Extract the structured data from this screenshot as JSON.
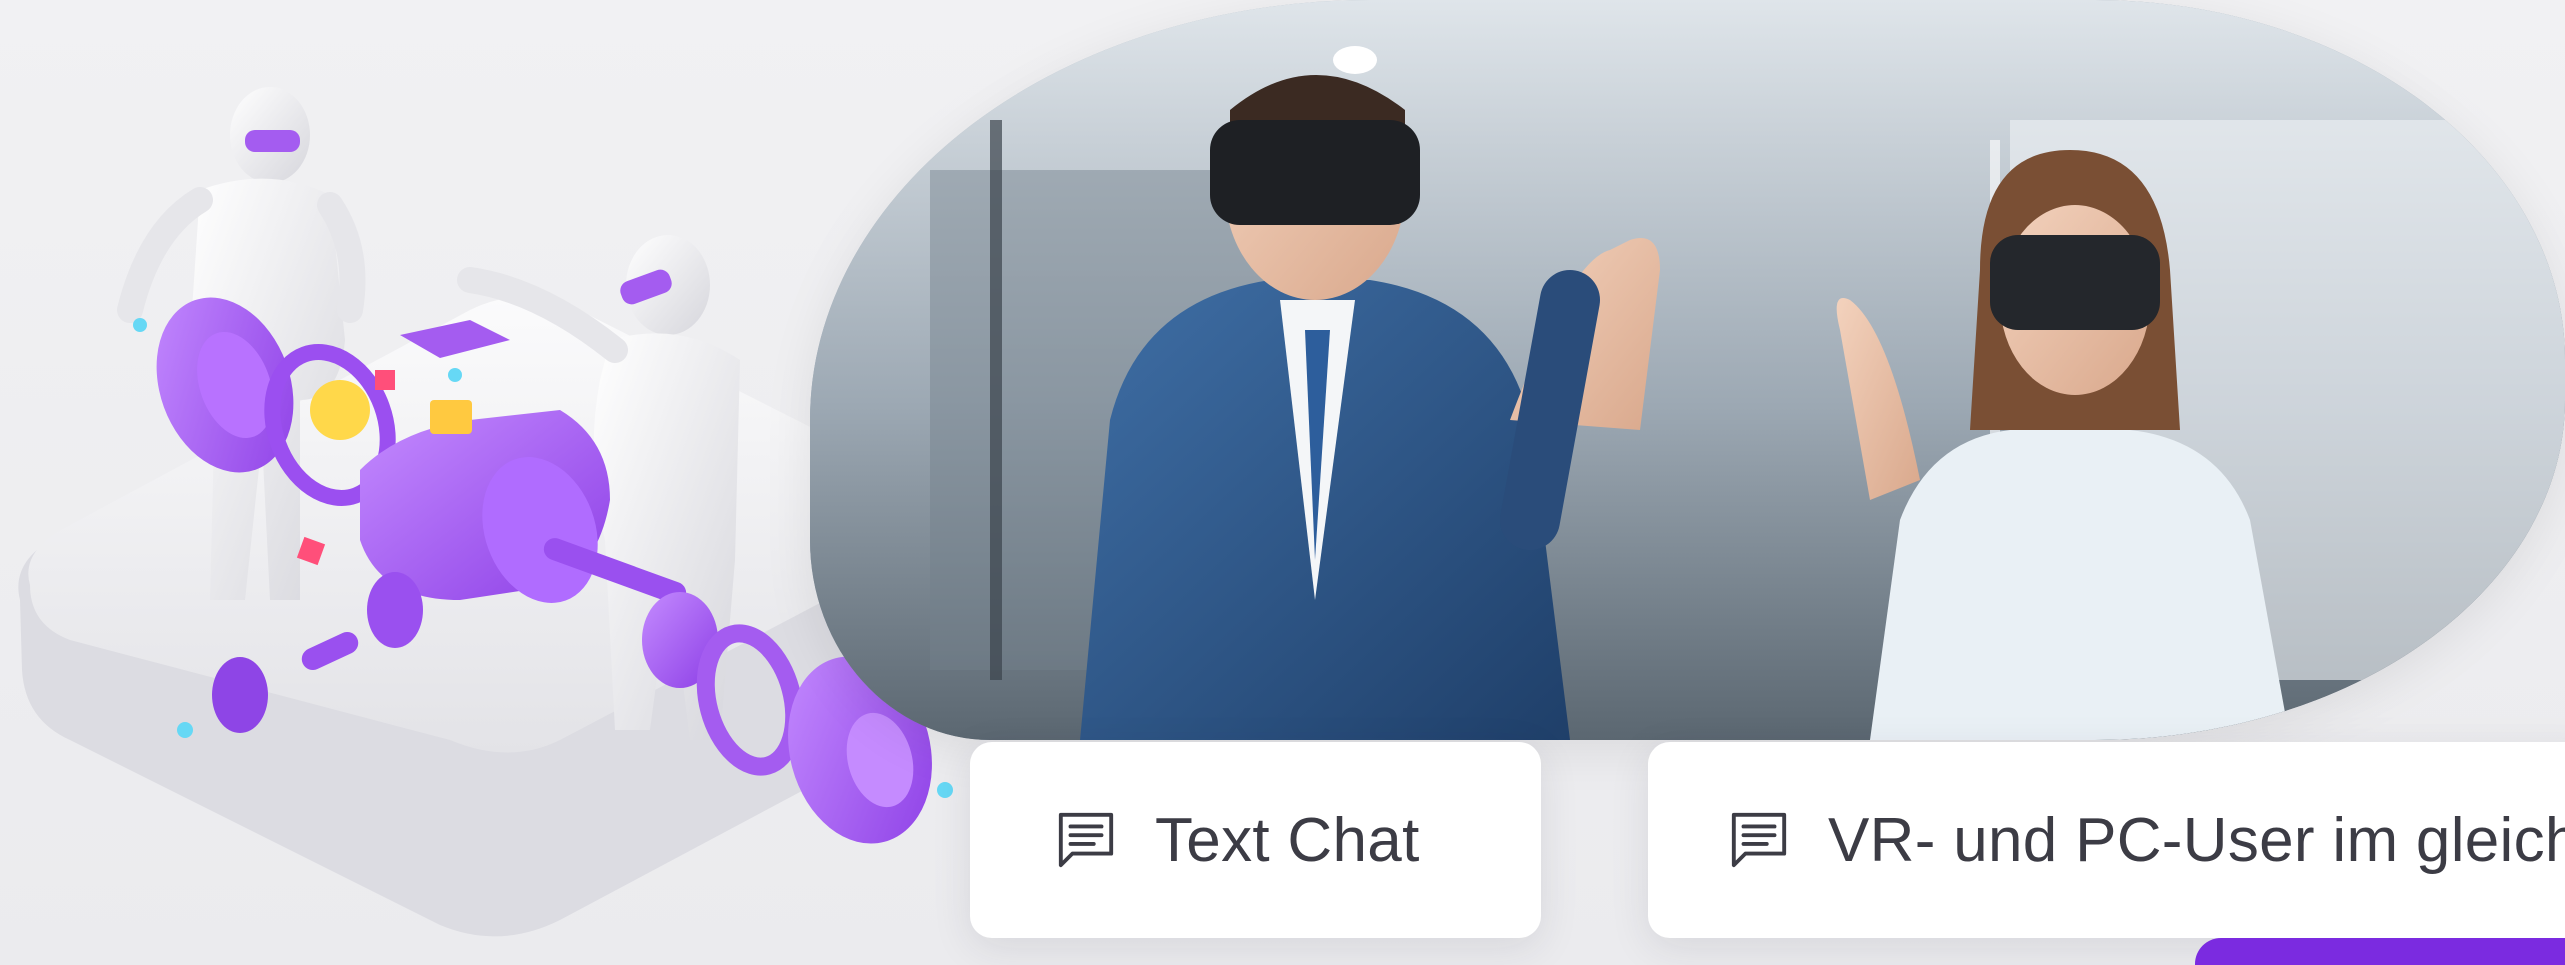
{
  "cards": [
    {
      "icon": "chat-icon",
      "label": "Text Chat"
    },
    {
      "icon": "chat-icon",
      "label": "VR- und PC-User im gleichen Raum"
    }
  ],
  "colors": {
    "accent": "#7b2be0",
    "illustration_purple": "#a45cf0",
    "card_background": "#ffffff",
    "text": "#3c3c45",
    "background": "#eeeef0"
  },
  "images": {
    "illustration": "isometric-collaboration-illustration",
    "photo": "vr-headset-users-photo"
  }
}
